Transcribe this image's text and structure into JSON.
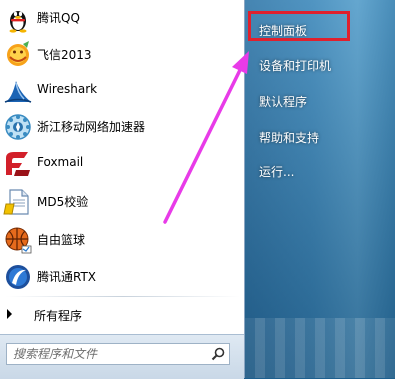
{
  "programs": [
    {
      "label": "腾讯QQ",
      "icon": "qq-penguin-icon"
    },
    {
      "label": "飞信2013",
      "icon": "fetion-icon"
    },
    {
      "label": "Wireshark",
      "icon": "wireshark-fin-icon"
    },
    {
      "label": "浙江移动网络加速器",
      "icon": "network-accelerator-icon"
    },
    {
      "label": "Foxmail",
      "icon": "foxmail-icon"
    },
    {
      "label": "MD5校验",
      "icon": "md5-document-icon"
    },
    {
      "label": "自由篮球",
      "icon": "basketball-icon"
    },
    {
      "label": "腾讯通RTX",
      "icon": "rtx-icon"
    }
  ],
  "all_programs_label": "所有程序",
  "search": {
    "placeholder": "搜索程序和文件"
  },
  "right_items": [
    {
      "label": "控制面板",
      "highlighted": true
    },
    {
      "label": "设备和打印机"
    },
    {
      "label": "默认程序"
    },
    {
      "label": "帮助和支持"
    },
    {
      "label": "运行..."
    }
  ],
  "colors": {
    "highlight_border": "#e0202d",
    "annotation_arrow": "#e83be8",
    "right_pane": "#3b86b6"
  }
}
